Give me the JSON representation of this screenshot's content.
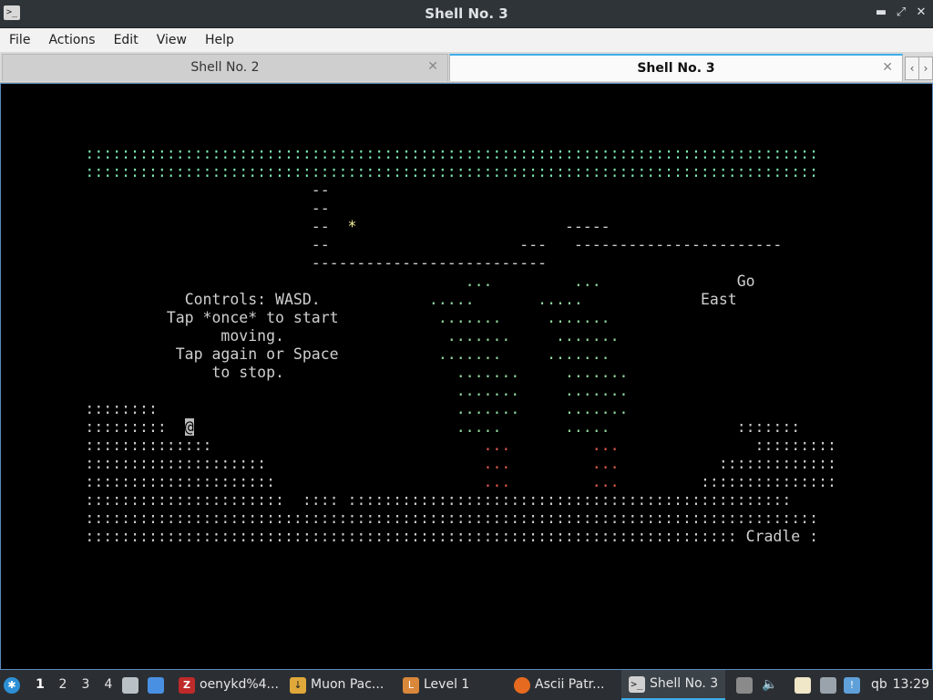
{
  "window": {
    "title": "Shell No. 3"
  },
  "menu": [
    "File",
    "Actions",
    "Edit",
    "View",
    "Help"
  ],
  "tabs": [
    {
      "label": "Shell No. 2",
      "active": false
    },
    {
      "label": "Shell No. 3",
      "active": true
    }
  ],
  "terminal": {
    "stars_row": ":::::::::::::::::::::::::::::::::::::::::::::::::::::::::::::::::::::::::::::::::",
    "ceiling_1": "--",
    "ceiling_2": "--",
    "ceiling_3": "--",
    "star": "*",
    "ceiling_4": "--",
    "ledge_top": "-----",
    "ledge_mid_a": "---",
    "ledge_mid_b": "-----------------------",
    "floor_platform": "--------------------------",
    "go": "Go",
    "east": "East",
    "controls_1": "Controls: WASD.",
    "controls_2": "Tap *once* to start",
    "controls_3": "moving.",
    "controls_4": "Tap again or Space",
    "controls_5": "to stop.",
    "player": "@",
    "cradle": "Cradle",
    "ground_end": ":"
  },
  "taskbar": {
    "workspaces": [
      "1",
      "2",
      "3",
      "4"
    ],
    "active_workspace": "1",
    "tasks": [
      {
        "label": "oenykd%4...",
        "icon": "filezilla-icon"
      },
      {
        "label": "Muon Pac...",
        "icon": "muon-icon"
      },
      {
        "label": "Level 1",
        "icon": "level-icon"
      },
      {
        "label": "Ascii Patr...",
        "icon": "firefox-icon"
      },
      {
        "label": "Shell No. 3",
        "icon": "terminal-icon",
        "active": true
      }
    ],
    "tray_text": "qb",
    "clock": "13:29"
  },
  "colors": {
    "accent": "#3daee9",
    "terminal_bg": "#000000",
    "tree_green": "#7de8b0",
    "trunk_red": "#e05a4e",
    "star_yellow": "#f5f5a0"
  }
}
